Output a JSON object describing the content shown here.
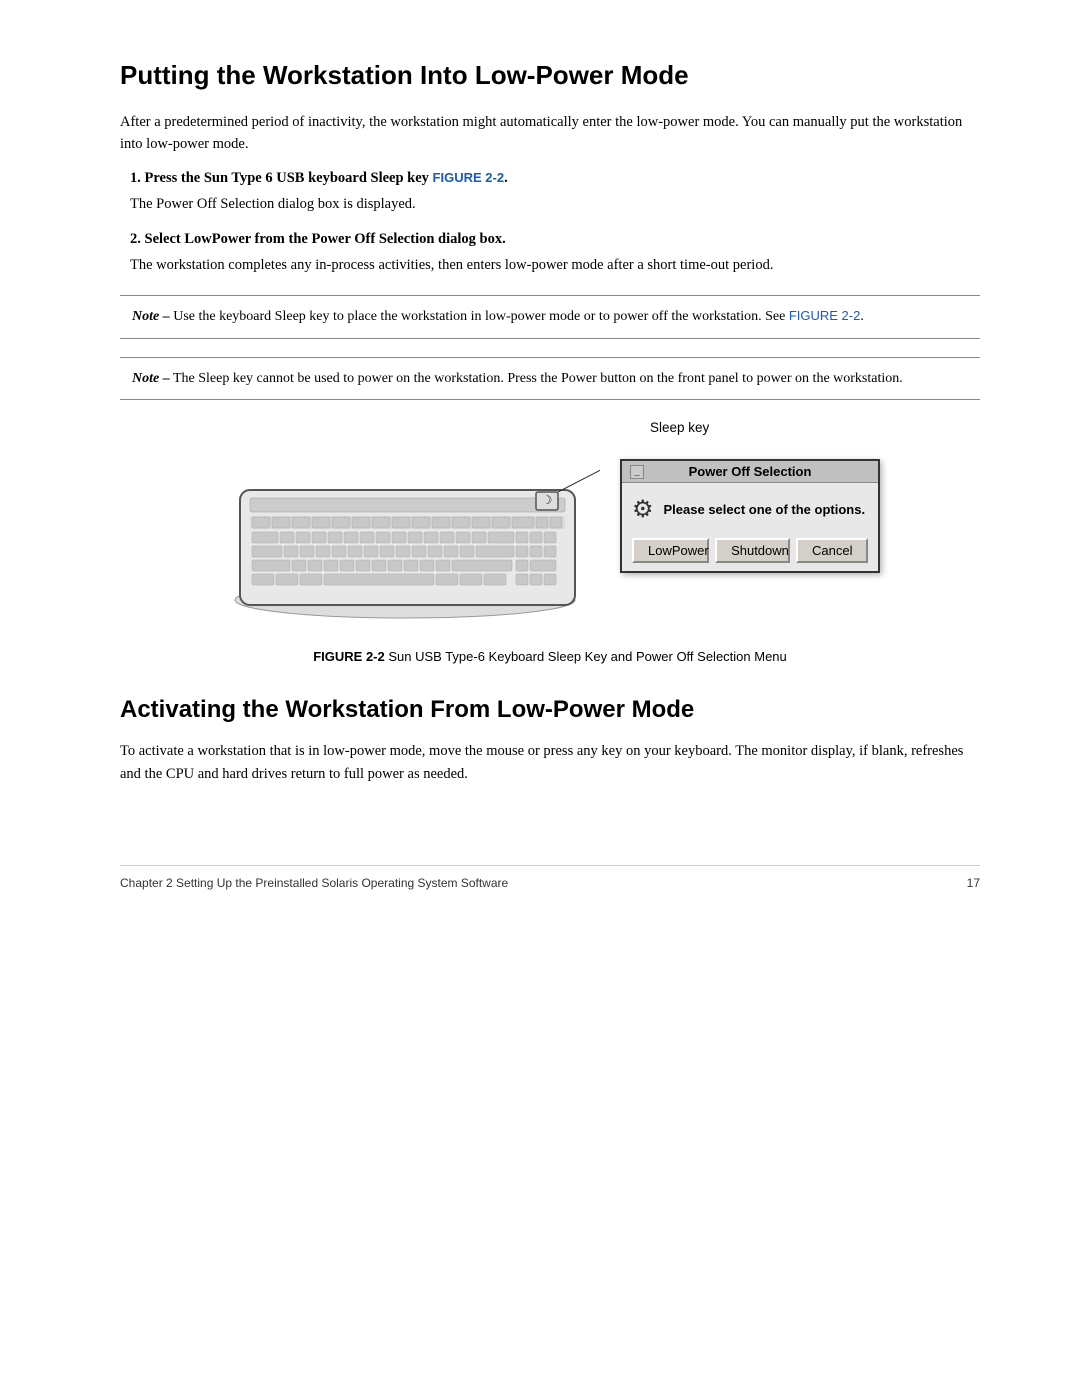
{
  "page": {
    "section1": {
      "title": "Putting the Workstation Into Low-Power Mode",
      "intro": "After a predetermined period of inactivity, the workstation might automatically enter the low-power mode. You can manually put the workstation into low-power mode.",
      "steps": [
        {
          "number": "1.",
          "label_pre": "Press the Sun Type 6 USB keyboard Sleep key ",
          "label_link": "FIGURE 2-2",
          "label_post": ".",
          "body": "The Power Off Selection dialog box is displayed."
        },
        {
          "number": "2.",
          "label": "Select LowPower from the Power Off Selection dialog box.",
          "body": "The workstation completes any in-process activities, then enters low-power mode after a short time-out period."
        }
      ],
      "note1": {
        "prefix": "Note –",
        "text": " Use the keyboard Sleep key to place the workstation in low-power mode or to power off the workstation. See ",
        "link": "FIGURE 2-2",
        "suffix": "."
      },
      "note2": {
        "prefix": "Note –",
        "text": " The Sleep key cannot be used to power on the workstation. Press the Power button on the front panel to power on the workstation."
      }
    },
    "figure": {
      "label": "Sleep key",
      "caption_bold": "FIGURE 2-2",
      "caption_text": "   Sun USB Type-6 Keyboard Sleep Key and Power Off Selection Menu",
      "dialog": {
        "title": "Power Off Selection",
        "message": "Please select one of the options.",
        "buttons": [
          "LowPower",
          "Shutdown",
          "Cancel"
        ]
      }
    },
    "section2": {
      "title": "Activating the Workstation From Low-Power Mode",
      "body": "To activate a workstation that is in low-power mode, move the mouse or press any key on your keyboard. The monitor display, if blank, refreshes and the CPU and hard drives return to full power as needed."
    },
    "footer": {
      "left": "Chapter 2   Setting Up the Preinstalled Solaris Operating System Software",
      "right": "17"
    }
  }
}
